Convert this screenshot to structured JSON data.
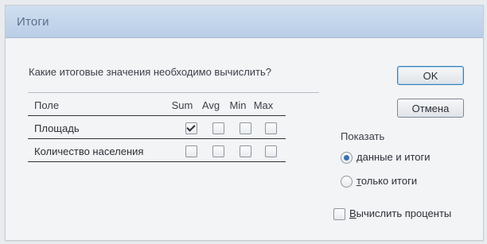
{
  "dialog": {
    "title": "Итоги"
  },
  "question": "Какие итоговые значения необходимо вычислить?",
  "table": {
    "field_header": "Поле",
    "columns": [
      "Sum",
      "Avg",
      "Min",
      "Max"
    ],
    "rows": [
      {
        "label": "Площадь",
        "checks": [
          true,
          false,
          false,
          false
        ]
      },
      {
        "label": "Количество населения",
        "checks": [
          false,
          false,
          false,
          false
        ]
      }
    ]
  },
  "buttons": {
    "ok": "OK",
    "cancel": "Отмена"
  },
  "show_group": {
    "label": "Показать",
    "options": [
      {
        "first_letter": "д",
        "rest": "анные и итоги",
        "selected": true
      },
      {
        "first_letter": "т",
        "rest": "олько итоги",
        "selected": false
      }
    ]
  },
  "percent_option": {
    "first_letter": "В",
    "rest": "ычислить проценты",
    "checked": false
  },
  "colors": {
    "titlebar": "#c6d8ee",
    "accent": "#3b6fb0"
  }
}
